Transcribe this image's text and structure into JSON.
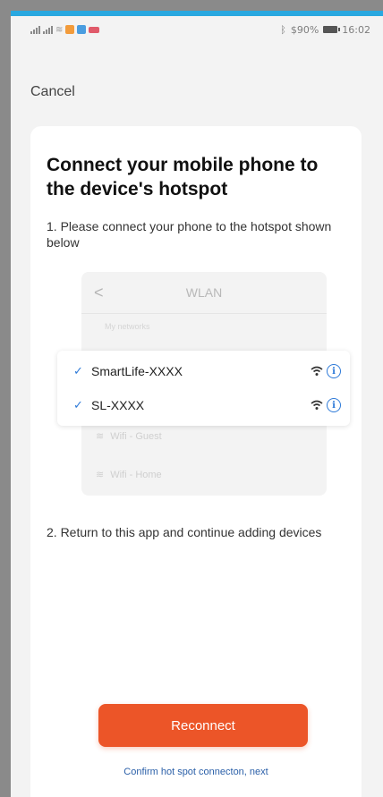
{
  "statusbar": {
    "left_icons": "signal-wifi-notification-icons",
    "battery_text": "$90%",
    "time": "16:02",
    "bluetooth_icon": "ᛒ"
  },
  "nav": {
    "cancel_label": "Cancel"
  },
  "card": {
    "title": "Connect your mobile phone to the device's hotspot",
    "step1": "1. Please connect your phone to the hotspot shown below",
    "step2": "2. Return to this app and continue adding devices"
  },
  "wlan": {
    "back_icon": "<",
    "title": "WLAN",
    "subheading": "My networks",
    "networks": [
      {
        "name": "SmartLife-XXXX",
        "check_icon": "check-icon",
        "connected": true
      },
      {
        "name": "SL-XXXX",
        "check_icon": "check-icon",
        "connected": true
      }
    ],
    "other_networks": [
      {
        "name": "Wifi - Guest"
      },
      {
        "name": "Wifi - Home"
      }
    ],
    "info_icon_glyph": "i",
    "check_glyph": "✓",
    "wifi_glyph": "≋"
  },
  "actions": {
    "reconnect_label": "Reconnect",
    "confirm_link": "Confirm hot spot connecton, next"
  },
  "colors": {
    "accent_top": "#29a8e0",
    "button": "#ec5528",
    "link": "#2a5fa8",
    "check": "#2e7ad8"
  }
}
